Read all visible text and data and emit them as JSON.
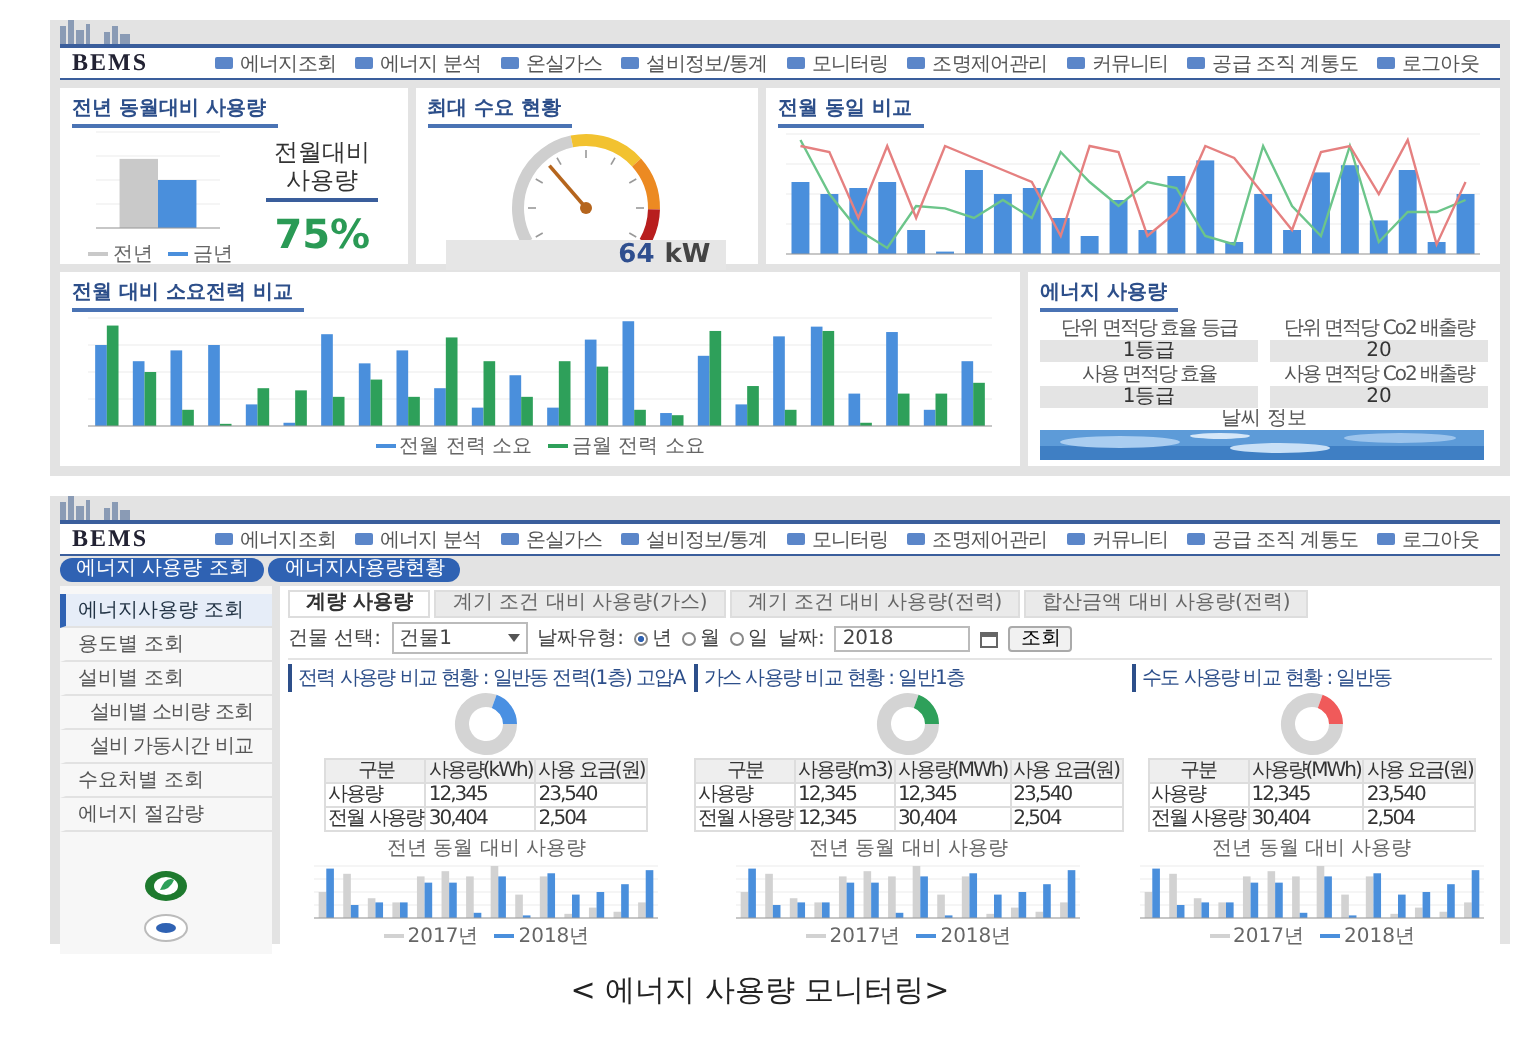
{
  "top_screen": {
    "logo": "BEMS",
    "menu": [
      "에너지조회",
      "에너지 분석",
      "온실가스",
      "설비정보/통계",
      "모니터링",
      "조명제어관리",
      "커뮤니티",
      "공급 조직 계통도",
      "로그아웃"
    ],
    "yoy": {
      "title": "전년 동월대비 사용량",
      "callout_title": "전월대비 사용량",
      "callout_value": "75%",
      "legend": [
        "전년",
        "금년"
      ]
    },
    "peak": {
      "title": "최대 수요 현황",
      "reading": "64",
      "unit": "kW"
    },
    "monthly": {
      "title": "전월 동일 비교"
    },
    "power": {
      "title": "전월 대비 소요전력 비교",
      "legend": [
        "전월 전력 소요",
        "금월 전력 소요"
      ]
    },
    "energy": {
      "title": "에너지 사용량",
      "stats": [
        {
          "label": "단위 면적당 효율 등급",
          "value": "1등급"
        },
        {
          "label": "단위 면적당 Co2 배출량",
          "value": "20"
        },
        {
          "label": "사용 면적당 효율",
          "value": "1등급"
        },
        {
          "label": "사용 면적당 Co2 배출량",
          "value": "20"
        }
      ],
      "weather_label": "날씨 정보"
    }
  },
  "bottom_screen": {
    "logo": "BEMS",
    "menu": [
      "에너지조회",
      "에너지 분석",
      "온실가스",
      "설비정보/통계",
      "모니터링",
      "조명제어관리",
      "커뮤니티",
      "공급 조직 계통도",
      "로그아웃"
    ],
    "pills": [
      "에너지 사용량 조회",
      "에너지사용량현황"
    ],
    "sidebar": [
      {
        "label": "에너지사용량 조회",
        "selected": true
      },
      {
        "label": "용도별 조회",
        "selected": false
      },
      {
        "label": "설비별 조회",
        "selected": false,
        "children": [
          {
            "label": "설비별 소비량 조회",
            "selected": false
          },
          {
            "label": "설비 가동시간 비교",
            "selected": false
          }
        ]
      },
      {
        "label": "수요처별 조회",
        "selected": false
      },
      {
        "label": "에너지 절감량",
        "selected": false
      }
    ],
    "tabs": [
      {
        "label": "계량 사용량",
        "selected": true
      },
      {
        "label": "계기 조건 대비 사용량(가스)",
        "selected": false
      },
      {
        "label": "계기 조건 대비 사용량(전력)",
        "selected": false
      },
      {
        "label": "합산금액 대비 사용량(전력)",
        "selected": false
      }
    ],
    "filter": {
      "building_label": "건물 선택:",
      "building_value": "건물1",
      "type_label": "날짜유형:",
      "types": [
        {
          "label": "년",
          "selected": true
        },
        {
          "label": "월",
          "selected": false
        },
        {
          "label": "일",
          "selected": false
        }
      ],
      "date_label": "날짜:",
      "date_value": "2018",
      "search_button": "조회"
    },
    "sections": [
      {
        "title": "전력 사용량 비교 현황 : 일반동 전력(1층) 고압A",
        "color": "#4a90e2",
        "columns": [
          "구분",
          "사용량(kWh)",
          "사용 요금(원)"
        ],
        "rows": [
          [
            "사용량",
            "12,345",
            "23,540"
          ],
          [
            "전월 사용량",
            "30,404",
            "2,504"
          ]
        ],
        "chart_title": "전년 동월 대비 사용량",
        "legend": [
          "2017년",
          "2018년"
        ]
      },
      {
        "title": "가스 사용량 비교 현황 : 일반1층",
        "color": "#2ea05a",
        "columns": [
          "구분",
          "사용량(m3)",
          "사용량(MWh)",
          "사용 요금(원)"
        ],
        "rows": [
          [
            "사용량",
            "12,345",
            "12,345",
            "23,540"
          ],
          [
            "전월 사용량",
            "12,345",
            "30,404",
            "2,504"
          ]
        ],
        "chart_title": "전년 동월 대비 사용량",
        "legend": [
          "2017년",
          "2018년"
        ]
      },
      {
        "title": "수도 사용량 비교 현황 : 일반동",
        "color": "#f05a5a",
        "columns": [
          "구분",
          "사용량(MWh)",
          "사용 요금(원)"
        ],
        "rows": [
          [
            "사용량",
            "12,345",
            "23,540"
          ],
          [
            "전월 사용량",
            "30,404",
            "2,504"
          ]
        ],
        "chart_title": "전년 동월 대비 사용량",
        "legend": [
          "2017년",
          "2018년"
        ]
      }
    ]
  },
  "caption": "< 에너지 사용량 모니터링>"
}
